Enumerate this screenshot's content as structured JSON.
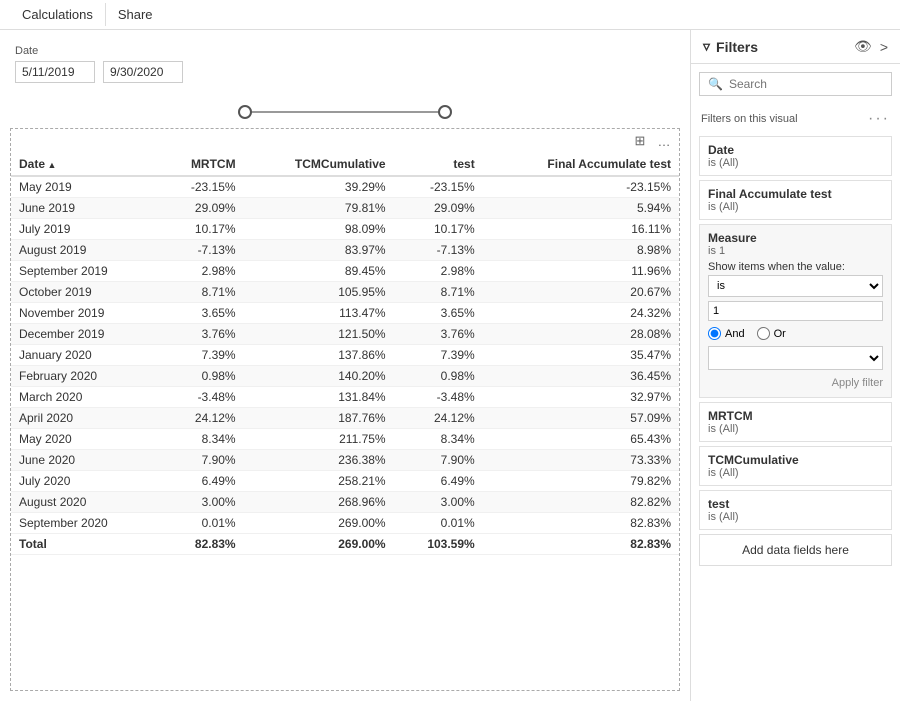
{
  "topbar": {
    "items": [
      "Calculations",
      "Share"
    ]
  },
  "dateFilter": {
    "label": "Date",
    "startDate": "5/11/2019",
    "endDate": "9/30/2020"
  },
  "table": {
    "columns": [
      {
        "key": "date",
        "label": "Date",
        "type": "text",
        "sortAsc": true
      },
      {
        "key": "mrtcm",
        "label": "MRTCM",
        "type": "number"
      },
      {
        "key": "tcmCumulative",
        "label": "TCMCumulative",
        "type": "number"
      },
      {
        "key": "test",
        "label": "test",
        "type": "number"
      },
      {
        "key": "finalAccumulate",
        "label": "Final Accumulate test",
        "type": "number"
      }
    ],
    "rows": [
      {
        "date": "May 2019",
        "mrtcm": "-23.15%",
        "tcmCumulative": "39.29%",
        "test": "-23.15%",
        "finalAccumulate": "-23.15%"
      },
      {
        "date": "June 2019",
        "mrtcm": "29.09%",
        "tcmCumulative": "79.81%",
        "test": "29.09%",
        "finalAccumulate": "5.94%"
      },
      {
        "date": "July 2019",
        "mrtcm": "10.17%",
        "tcmCumulative": "98.09%",
        "test": "10.17%",
        "finalAccumulate": "16.11%"
      },
      {
        "date": "August 2019",
        "mrtcm": "-7.13%",
        "tcmCumulative": "83.97%",
        "test": "-7.13%",
        "finalAccumulate": "8.98%"
      },
      {
        "date": "September 2019",
        "mrtcm": "2.98%",
        "tcmCumulative": "89.45%",
        "test": "2.98%",
        "finalAccumulate": "11.96%"
      },
      {
        "date": "October 2019",
        "mrtcm": "8.71%",
        "tcmCumulative": "105.95%",
        "test": "8.71%",
        "finalAccumulate": "20.67%"
      },
      {
        "date": "November 2019",
        "mrtcm": "3.65%",
        "tcmCumulative": "113.47%",
        "test": "3.65%",
        "finalAccumulate": "24.32%"
      },
      {
        "date": "December 2019",
        "mrtcm": "3.76%",
        "tcmCumulative": "121.50%",
        "test": "3.76%",
        "finalAccumulate": "28.08%"
      },
      {
        "date": "January 2020",
        "mrtcm": "7.39%",
        "tcmCumulative": "137.86%",
        "test": "7.39%",
        "finalAccumulate": "35.47%"
      },
      {
        "date": "February 2020",
        "mrtcm": "0.98%",
        "tcmCumulative": "140.20%",
        "test": "0.98%",
        "finalAccumulate": "36.45%"
      },
      {
        "date": "March 2020",
        "mrtcm": "-3.48%",
        "tcmCumulative": "131.84%",
        "test": "-3.48%",
        "finalAccumulate": "32.97%"
      },
      {
        "date": "April 2020",
        "mrtcm": "24.12%",
        "tcmCumulative": "187.76%",
        "test": "24.12%",
        "finalAccumulate": "57.09%"
      },
      {
        "date": "May 2020",
        "mrtcm": "8.34%",
        "tcmCumulative": "211.75%",
        "test": "8.34%",
        "finalAccumulate": "65.43%"
      },
      {
        "date": "June 2020",
        "mrtcm": "7.90%",
        "tcmCumulative": "236.38%",
        "test": "7.90%",
        "finalAccumulate": "73.33%"
      },
      {
        "date": "July 2020",
        "mrtcm": "6.49%",
        "tcmCumulative": "258.21%",
        "test": "6.49%",
        "finalAccumulate": "79.82%"
      },
      {
        "date": "August 2020",
        "mrtcm": "3.00%",
        "tcmCumulative": "268.96%",
        "test": "3.00%",
        "finalAccumulate": "82.82%"
      },
      {
        "date": "September 2020",
        "mrtcm": "0.01%",
        "tcmCumulative": "269.00%",
        "test": "0.01%",
        "finalAccumulate": "82.83%"
      }
    ],
    "totalRow": {
      "label": "Total",
      "mrtcm": "82.83%",
      "tcmCumulative": "269.00%",
      "test": "103.59%",
      "finalAccumulate": "82.83%"
    }
  },
  "rightPanel": {
    "title": "Filters",
    "searchPlaceholder": "Search",
    "filtersOnVisualLabel": "Filters on this visual",
    "filters": [
      {
        "name": "Date",
        "condition": "is (All)"
      },
      {
        "name": "Final Accumulate test",
        "condition": "is (All)"
      },
      {
        "name": "Measure",
        "condition": "is 1",
        "isActive": true,
        "showItemsLabel": "Show items when the value:",
        "conditionSelect": "is",
        "conditionValue": "1",
        "radioAnd": true,
        "applyFilterLabel": "Apply filter"
      },
      {
        "name": "MRTCM",
        "condition": "is (All)"
      },
      {
        "name": "TCMCumulative",
        "condition": "is (All)"
      },
      {
        "name": "test",
        "condition": "is (All)"
      }
    ],
    "addDataFieldsLabel": "Add data fields here"
  }
}
